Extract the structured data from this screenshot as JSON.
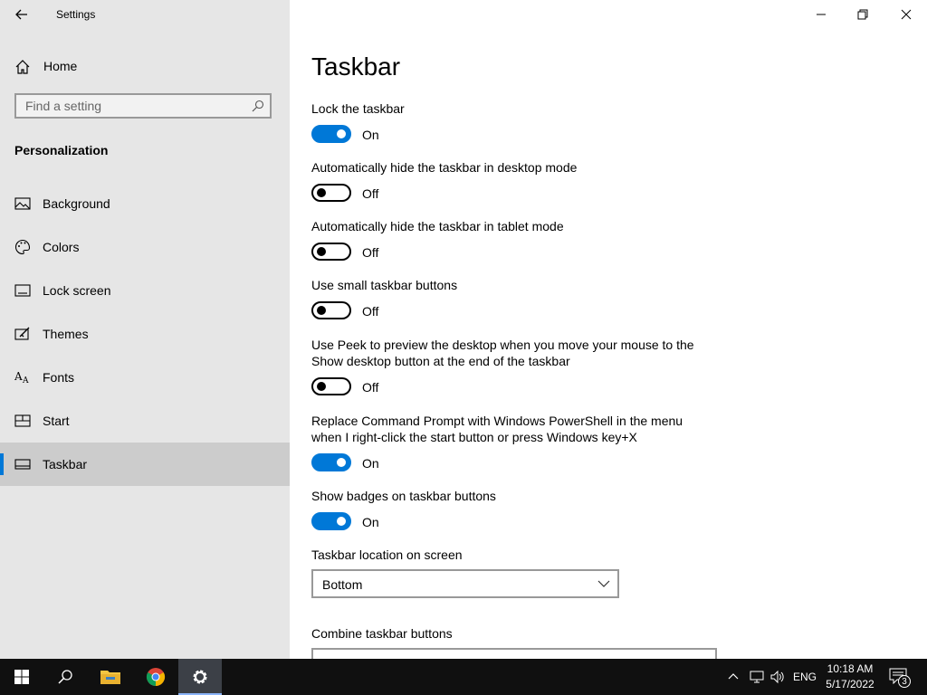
{
  "window": {
    "app_title": "Settings"
  },
  "sidebar": {
    "home_label": "Home",
    "search_placeholder": "Find a setting",
    "section_title": "Personalization",
    "items": [
      {
        "label": "Background",
        "icon": "picture-icon"
      },
      {
        "label": "Colors",
        "icon": "palette-icon"
      },
      {
        "label": "Lock screen",
        "icon": "lock-screen-icon"
      },
      {
        "label": "Themes",
        "icon": "themes-icon"
      },
      {
        "label": "Fonts",
        "icon": "fonts-icon"
      },
      {
        "label": "Start",
        "icon": "start-icon"
      },
      {
        "label": "Taskbar",
        "icon": "taskbar-icon",
        "active": true
      }
    ]
  },
  "main": {
    "title": "Taskbar",
    "settings": [
      {
        "label": "Lock the taskbar",
        "state": "On"
      },
      {
        "label": "Automatically hide the taskbar in desktop mode",
        "state": "Off"
      },
      {
        "label": "Automatically hide the taskbar in tablet mode",
        "state": "Off"
      },
      {
        "label": "Use small taskbar buttons",
        "state": "Off"
      },
      {
        "label": "Use Peek to preview the desktop when you move your mouse to the Show desktop button at the end of the taskbar",
        "state": "Off"
      },
      {
        "label": "Replace Command Prompt with Windows PowerShell in the menu when I right-click the start button or press Windows key+X",
        "state": "On"
      },
      {
        "label": "Show badges on taskbar buttons",
        "state": "On"
      }
    ],
    "location_label": "Taskbar location on screen",
    "location_value": "Bottom",
    "combine_label": "Combine taskbar buttons"
  },
  "taskbar": {
    "language": "ENG",
    "time": "10:18 AM",
    "date": "5/17/2022",
    "notification_count": "3"
  },
  "colors": {
    "accent": "#0078d7",
    "sidebar_bg": "#e6e6e6",
    "taskbar_bg": "#101010"
  }
}
